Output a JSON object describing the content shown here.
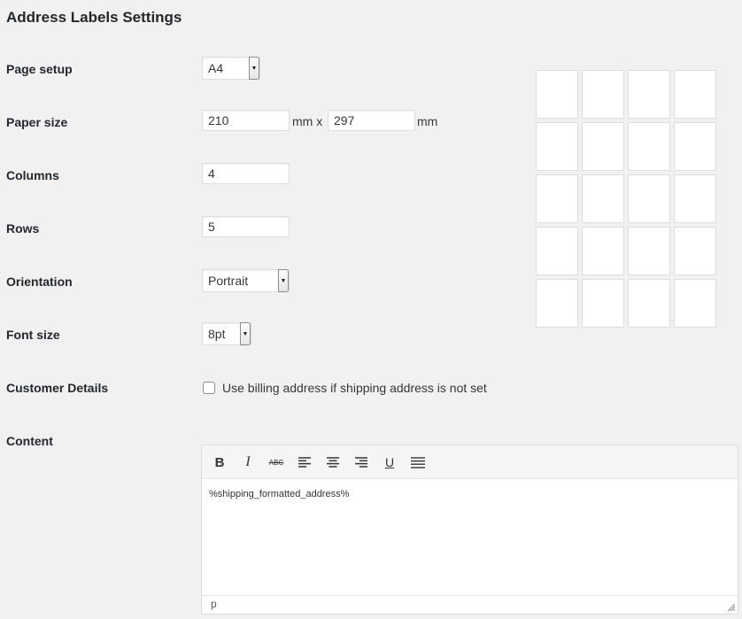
{
  "page": {
    "title": "Address Labels Settings"
  },
  "fields": {
    "page_setup": {
      "label": "Page setup",
      "value": "A4"
    },
    "paper_size": {
      "label": "Paper size",
      "width": "210",
      "height": "297",
      "unit_x": "mm x",
      "unit": "mm"
    },
    "columns": {
      "label": "Columns",
      "value": "4"
    },
    "rows": {
      "label": "Rows",
      "value": "5"
    },
    "orientation": {
      "label": "Orientation",
      "value": "Portrait"
    },
    "font_size": {
      "label": "Font size",
      "value": "8pt"
    },
    "customer_details": {
      "label": "Customer Details",
      "checkbox_label": "Use billing address if shipping address is not set",
      "checked": false
    },
    "content": {
      "label": "Content"
    }
  },
  "preview": {
    "columns": 4,
    "rows": 5
  },
  "editor": {
    "toolbar": [
      "bold-icon",
      "italic-icon",
      "strikethrough-icon",
      "align-left-icon",
      "align-center-icon",
      "align-right-icon",
      "underline-icon",
      "justify-icon"
    ],
    "bold_glyph": "B",
    "italic_glyph": "I",
    "strike_glyph": "ABC",
    "underline_glyph": "U",
    "content": "%shipping_formatted_address%",
    "status_path": "p"
  }
}
